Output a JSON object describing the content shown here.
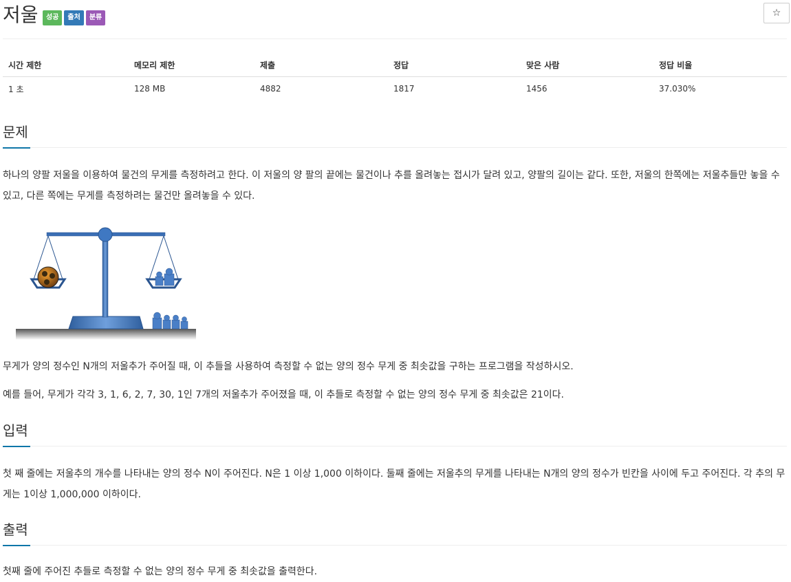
{
  "header": {
    "title": "저울",
    "labels": [
      {
        "text": "성공",
        "color": "#5cb85c"
      },
      {
        "text": "출처",
        "color": "#337ab7"
      },
      {
        "text": "분류",
        "color": "#9b59b6"
      }
    ],
    "star_icon": "☆"
  },
  "info_table": {
    "headers": [
      "시간 제한",
      "메모리 제한",
      "제출",
      "정답",
      "맞은 사람",
      "정답 비율"
    ],
    "values": [
      "1 초",
      "128 MB",
      "4882",
      "1817",
      "1456",
      "37.030%"
    ]
  },
  "sections": {
    "problem": {
      "title": "문제",
      "p1": "하나의 양팔 저울을 이용하여 물건의 무게를 측정하려고 한다. 이 저울의 양 팔의 끝에는 물건이나 추를 올려놓는 접시가 달려 있고, 양팔의 길이는 같다. 또한, 저울의 한쪽에는 저울추들만 놓을 수 있고, 다른 쪽에는 무게를 측정하려는 물건만 올려놓을 수 있다.",
      "p2": "무게가 양의 정수인 N개의 저울추가 주어질 때, 이 추들을 사용하여 측정할 수 없는 양의 정수 무게 중 최솟값을 구하는 프로그램을 작성하시오.",
      "p3": "예를 들어, 무게가 각각 3, 1, 6, 2, 7, 30, 1인 7개의 저울추가 주어졌을 때, 이 추들로 측정할 수 없는 양의 정수 무게 중 최솟값은 21이다."
    },
    "input": {
      "title": "입력",
      "p1": "첫 째 줄에는 저울추의 개수를 나타내는 양의 정수 N이 주어진다. N은 1 이상 1,000 이하이다. 둘째 줄에는 저울추의 무게를 나타내는 N개의 양의 정수가 빈칸을 사이에 두고 주어진다. 각 추의 무게는 1이상 1,000,000 이하이다."
    },
    "output": {
      "title": "출력",
      "p1": "첫째 줄에 주어진 추들로 측정할 수 없는 양의 정수 무게 중 최솟값을 출력한다."
    }
  },
  "accent_color": "#0e76a8"
}
